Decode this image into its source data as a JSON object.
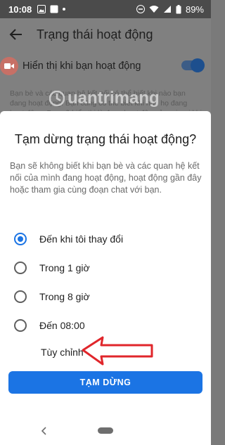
{
  "status_bar": {
    "time": "10:08",
    "battery": "89%"
  },
  "background": {
    "title": "Trạng thái hoạt động",
    "setting_label": "Hiển thị khi bạn hoạt động",
    "toggle_on": true,
    "description": "Bạn bè và các quan hệ kết nối có thể biết khi nào bạn đang hoạt động. Bạn cũng có thể biết khi nào họ đang hoạt động. Bạn sẽ hiển thị là đang hoạt động ở mọi nơi khi dùng Messenger hoặc Facebook để thay đổi trạng thái hoạt động của bạn."
  },
  "dialog": {
    "title": "Tạm dừng trạng thái hoạt động?",
    "description": "Bạn sẽ không biết khi bạn bè và các quan hệ kết nối của mình đang hoạt động, hoạt động gần đây hoặc tham gia cùng đoạn chat với bạn.",
    "options": [
      {
        "label": "Đến khi tôi thay đổi",
        "selected": true
      },
      {
        "label": "Trong 1 giờ",
        "selected": false
      },
      {
        "label": "Trong 8 giờ",
        "selected": false
      },
      {
        "label": "Đến 08:00",
        "selected": false
      }
    ],
    "custom_label": "Tùy chỉnh",
    "pause_button": "TẠM DỪNG"
  },
  "colors": {
    "accent": "#1b74e4",
    "annotation_arrow": "#e0262b"
  }
}
